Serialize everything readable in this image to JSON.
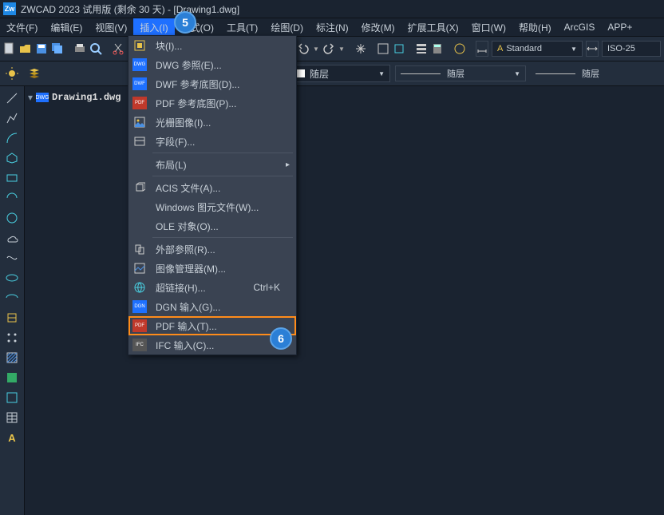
{
  "title": "ZWCAD 2023 试用版 (剩余 30 天) - [Drawing1.dwg]",
  "appLogo": "Zw",
  "menubar": [
    {
      "label": "文件(F)"
    },
    {
      "label": "编辑(E)"
    },
    {
      "label": "视图(V)"
    },
    {
      "label": "插入(I)",
      "active": true
    },
    {
      "label": "格式(O)"
    },
    {
      "label": "工具(T)"
    },
    {
      "label": "绘图(D)"
    },
    {
      "label": "标注(N)"
    },
    {
      "label": "修改(M)"
    },
    {
      "label": "扩展工具(X)"
    },
    {
      "label": "窗口(W)"
    },
    {
      "label": "帮助(H)"
    },
    {
      "label": "ArcGIS"
    },
    {
      "label": "APP+"
    }
  ],
  "layer_label": "随层",
  "layer_label2": "随层",
  "layer_label3": "随层",
  "style_standard": "Standard",
  "style_iso": "ISO-25",
  "doctab_name": "Drawing1.dwg",
  "dropdown": {
    "items": [
      {
        "icon": "block",
        "label": "块(I)..."
      },
      {
        "icon": "dwg",
        "label": "DWG 参照(E)..."
      },
      {
        "icon": "dwf",
        "label": "DWF 参考底图(D)..."
      },
      {
        "icon": "pdf",
        "label": "PDF 参考底图(P)..."
      },
      {
        "icon": "raster",
        "label": "光栅图像(I)..."
      },
      {
        "icon": "field",
        "label": "字段(F)..."
      },
      {
        "sep": true
      },
      {
        "icon": "",
        "label": "布局(L)",
        "submenu": true
      },
      {
        "sep": true
      },
      {
        "icon": "acis",
        "label": "ACIS 文件(A)..."
      },
      {
        "icon": "",
        "label": "Windows 图元文件(W)..."
      },
      {
        "icon": "",
        "label": "OLE 对象(O)..."
      },
      {
        "sep": true
      },
      {
        "icon": "xref",
        "label": "外部参照(R)..."
      },
      {
        "icon": "imgmgr",
        "label": "图像管理器(M)..."
      },
      {
        "icon": "link",
        "label": "超链接(H)...",
        "shortcut": "Ctrl+K"
      },
      {
        "icon": "dgn",
        "label": "DGN 输入(G)..."
      },
      {
        "icon": "pdfin",
        "label": "PDF 输入(T)...",
        "highlighted": true
      },
      {
        "icon": "ifc",
        "label": "IFC 输入(C)..."
      }
    ]
  },
  "callouts": {
    "c5": "5",
    "c6": "6"
  }
}
